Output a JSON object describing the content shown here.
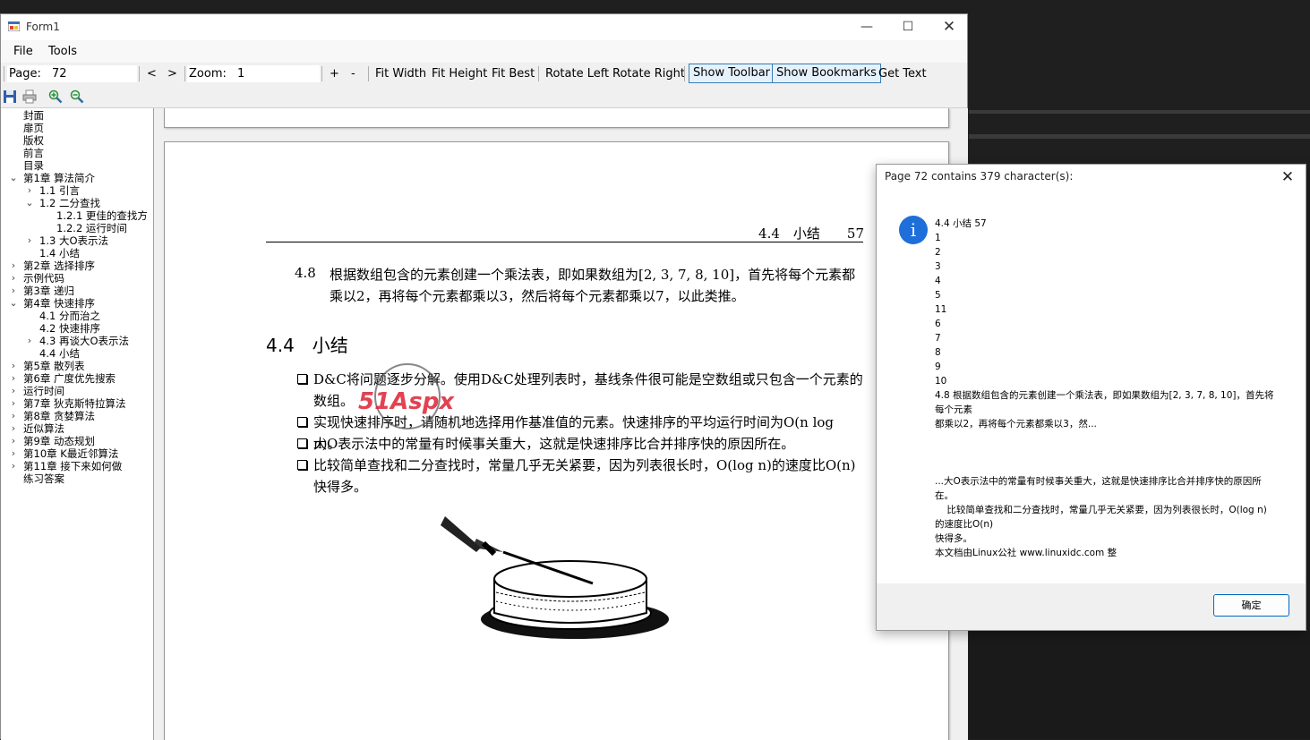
{
  "window": {
    "title": "Form1"
  },
  "menu": {
    "file": "File",
    "tools": "Tools"
  },
  "toolbar": {
    "page_label": "Page:",
    "page_value": "72",
    "prev": "<",
    "next": ">",
    "zoom_label": "Zoom:",
    "zoom_value": "1",
    "zoom_in": "+",
    "zoom_out": "-",
    "fit_width": "Fit Width",
    "fit_height": "Fit Height",
    "fit_best": "Fit Best",
    "rotate_left": "Rotate Left",
    "rotate_right": "Rotate Right",
    "show_toolbar": "Show Toolbar",
    "show_bookmarks": "Show Bookmarks",
    "get_text": "Get Text"
  },
  "toolbar2_icons": [
    "save-icon",
    "print-icon",
    "zoom-in-icon",
    "zoom-out-icon"
  ],
  "bookmarks": [
    {
      "label": "封面",
      "level": 0,
      "toggle": ""
    },
    {
      "label": "扉页",
      "level": 0,
      "toggle": ""
    },
    {
      "label": "版权",
      "level": 0,
      "toggle": ""
    },
    {
      "label": "前言",
      "level": 0,
      "toggle": ""
    },
    {
      "label": "目录",
      "level": 0,
      "toggle": ""
    },
    {
      "label": "第1章 算法简介",
      "level": 0,
      "toggle": "⌄"
    },
    {
      "label": "1.1 引言",
      "level": 1,
      "toggle": "›"
    },
    {
      "label": "1.2 二分查找",
      "level": 1,
      "toggle": "⌄"
    },
    {
      "label": "1.2.1 更佳的查找方",
      "level": 2,
      "toggle": ""
    },
    {
      "label": "1.2.2 运行时间",
      "level": 2,
      "toggle": ""
    },
    {
      "label": "1.3 大O表示法",
      "level": 1,
      "toggle": "›"
    },
    {
      "label": "1.4 小结",
      "level": 1,
      "toggle": ""
    },
    {
      "label": "第2章 选择排序",
      "level": 0,
      "toggle": "›"
    },
    {
      "label": "示例代码",
      "level": 0,
      "toggle": "›"
    },
    {
      "label": "第3章 递归",
      "level": 0,
      "toggle": "›"
    },
    {
      "label": "第4章 快速排序",
      "level": 0,
      "toggle": "⌄"
    },
    {
      "label": "4.1 分而治之",
      "level": 1,
      "toggle": ""
    },
    {
      "label": "4.2 快速排序",
      "level": 1,
      "toggle": ""
    },
    {
      "label": "4.3 再谈大O表示法",
      "level": 1,
      "toggle": "›"
    },
    {
      "label": "4.4 小结",
      "level": 1,
      "toggle": ""
    },
    {
      "label": "第5章 散列表",
      "level": 0,
      "toggle": "›"
    },
    {
      "label": "第6章 广度优先搜索",
      "level": 0,
      "toggle": "›"
    },
    {
      "label": "运行时间",
      "level": 0,
      "toggle": "›"
    },
    {
      "label": "第7章 狄克斯特拉算法",
      "level": 0,
      "toggle": "›"
    },
    {
      "label": "第8章 贪婪算法",
      "level": 0,
      "toggle": "›"
    },
    {
      "label": "近似算法",
      "level": 0,
      "toggle": "›"
    },
    {
      "label": "第9章 动态规划",
      "level": 0,
      "toggle": "›"
    },
    {
      "label": "第10章 K最近邻算法",
      "level": 0,
      "toggle": "›"
    },
    {
      "label": "第11章 接下来如何做",
      "level": 0,
      "toggle": "›"
    },
    {
      "label": "练习答案",
      "level": 0,
      "toggle": ""
    }
  ],
  "page": {
    "header": "4.4　小结　　57",
    "exercise_num": "4.8",
    "exercise_text": "根据数组包含的元素创建一个乘法表，即如果数组为[2, 3, 7, 8, 10]，首先将每个元素都乘以2，再将每个元素都乘以3，然后将每个元素都乘以7，以此类推。",
    "section_title": "4.4　小结",
    "bullets": [
      "D&C将问题逐步分解。使用D&C处理列表时，基线条件很可能是空数组或只包含一个元素的数组。",
      "实现快速排序时，请随机地选择用作基准值的元素。快速排序的平均运行时间为O(n log n)。",
      "大O表示法中的常量有时候事关重大，这就是快速排序比合并排序快的原因所在。",
      "比较简单查找和二分查找时，常量几乎无关紧要，因为列表很长时，O(log n)的速度比O(n)快得多。"
    ],
    "watermark": "51Aspx"
  },
  "dialog": {
    "title": "Page 72 contains 379 character(s):",
    "body": "4.4 小结 57\n1\n2\n3\n4\n5\n11\n6\n7\n8\n9\n10\n4.8 根据数组包含的元素创建一个乘法表，即如果数组为[2, 3, 7, 8, 10]，首先将每个元素\n都乘以2，再将每个元素都乘以3，然...\n\n\n\n...大O表示法中的常量有时候事关重大，这就是快速排序比合并排序快的原因所在。\n    比较简单查找和二分查找时，常量几乎无关紧要，因为列表很长时，O(log n)的速度比O(n)\n快得多。\n本文档由Linux公社 www.linuxidc.com 整",
    "ok": "确定"
  }
}
